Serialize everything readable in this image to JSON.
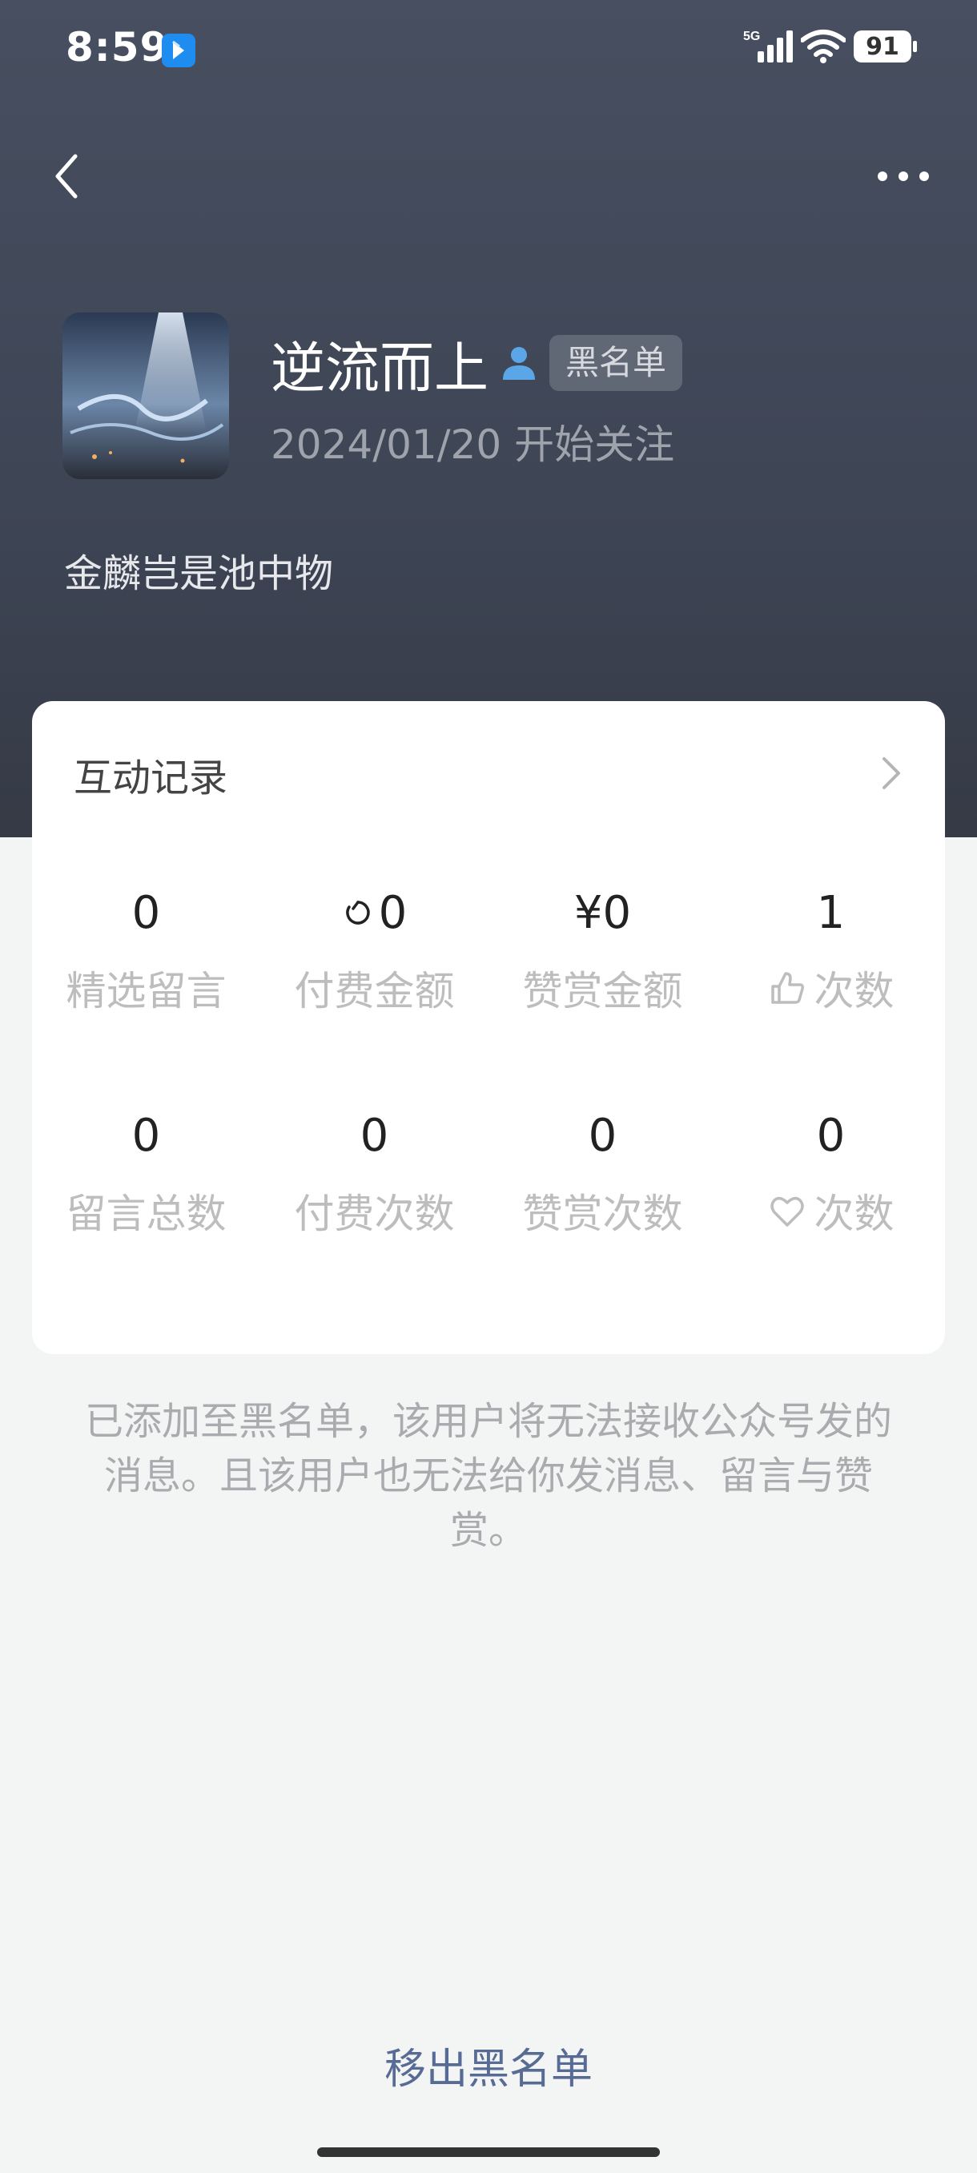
{
  "status_bar": {
    "time": "8:59",
    "network": "5G",
    "battery": "91"
  },
  "profile": {
    "nickname": "逆流而上",
    "tag": "黑名单",
    "follow_date": "2024/01/20 开始关注",
    "signature": "金麟岂是池中物"
  },
  "card": {
    "title": "互动记录",
    "stats": [
      {
        "value": "0",
        "label": "精选留言"
      },
      {
        "value": "0",
        "label": "付费金额"
      },
      {
        "value": "¥0",
        "label": "赞赏金额"
      },
      {
        "value": "1",
        "label": "次数"
      },
      {
        "value": "0",
        "label": "留言总数"
      },
      {
        "value": "0",
        "label": "付费次数"
      },
      {
        "value": "0",
        "label": "赞赏次数"
      },
      {
        "value": "0",
        "label": "次数"
      }
    ]
  },
  "notice": "已添加至黑名单，该用户将无法接收公众号发的消息。且该用户也无法给你发消息、留言与赞赏。",
  "remove_button": "移出黑名单",
  "colors": {
    "header_bg": "#474f60",
    "link": "#576b95",
    "page_bg": "#f3f4f4"
  }
}
